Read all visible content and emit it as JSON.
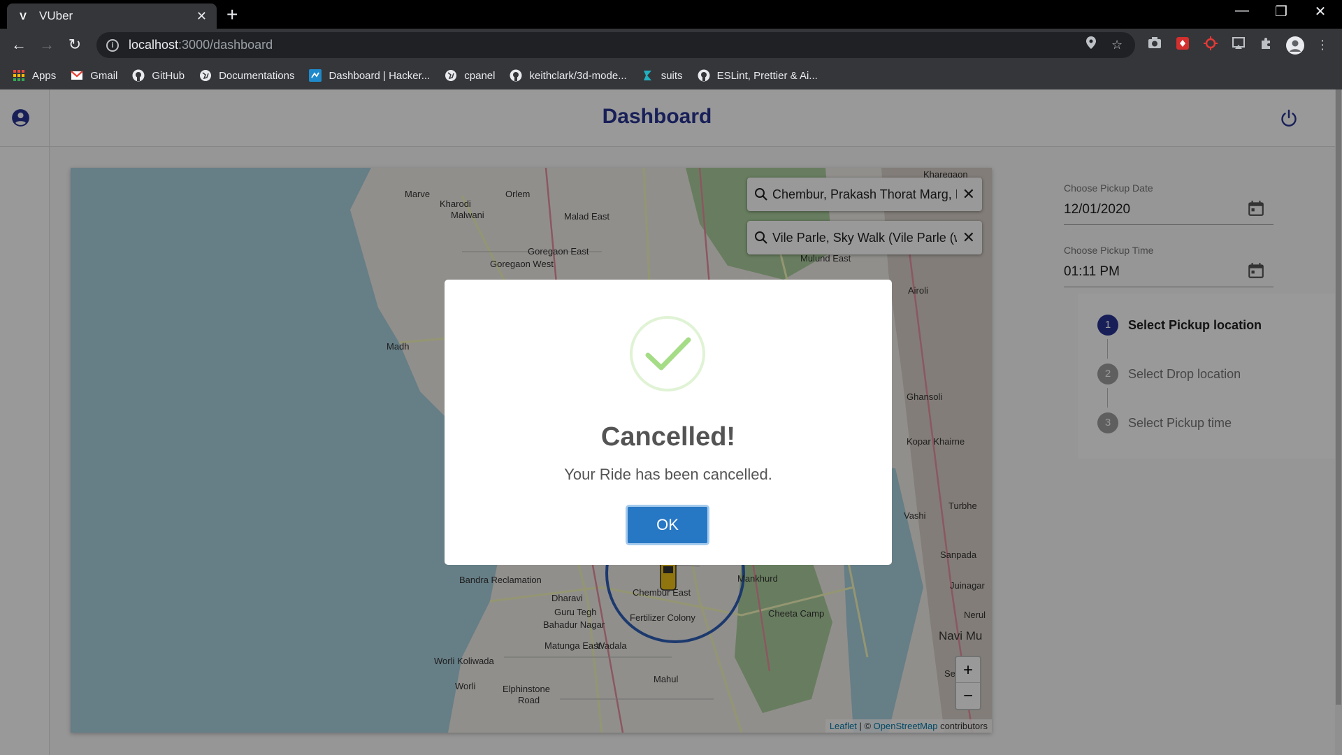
{
  "browser": {
    "tab_title": "VUber",
    "tab_close": "✕",
    "new_tab": "+",
    "url_host": "localhost",
    "url_path": ":3000/dashboard",
    "window_controls": [
      "—",
      "❐",
      "✕"
    ]
  },
  "bookmarks": [
    {
      "label": "Apps",
      "icon": "apps-grid-icon",
      "color": "#e8453c"
    },
    {
      "label": "Gmail",
      "icon": "gmail-icon",
      "color": "#ea4335"
    },
    {
      "label": "GitHub",
      "icon": "github-icon",
      "color": "#e8eaed"
    },
    {
      "label": "Documentations",
      "icon": "globe-icon",
      "color": "#e8eaed"
    },
    {
      "label": "Dashboard | Hacker...",
      "icon": "hackerrank-icon",
      "color": "#1f8acb"
    },
    {
      "label": "cpanel",
      "icon": "globe-icon",
      "color": "#e8eaed"
    },
    {
      "label": "keithclark/3d-mode...",
      "icon": "github-icon",
      "color": "#e8eaed"
    },
    {
      "label": "suits",
      "icon": "suits-icon",
      "color": "#21b0c0"
    },
    {
      "label": "ESLint, Prettier & Ai...",
      "icon": "github-icon",
      "color": "#e8eaed"
    }
  ],
  "app": {
    "title": "Dashboard",
    "accent": "#283593"
  },
  "map": {
    "search_pickup": "Chembur, Prakash Thorat Marg, P",
    "search_drop": "Vile Parle, Sky Walk (Vile Parle (w",
    "zoom_in": "+",
    "zoom_out": "−",
    "attribution_leaflet": "Leaflet",
    "attribution_sep": " | © ",
    "attribution_osm": "OpenStreetMap",
    "attribution_rest": " contributors",
    "labels": [
      "Kharegaon",
      "Marve",
      "Kharodi",
      "Orlem",
      "Malwani",
      "Malad East",
      "Goregaon East",
      "Goregaon West",
      "Mulund East",
      "Airoli",
      "Madh",
      "Ghansoli",
      "Kopar Khairne",
      "Turbhe",
      "Vashi",
      "Sanpada",
      "Juinagar",
      "Nerul",
      "Navi Mu",
      "Bandra Reclamation",
      "Dharavi",
      "Guru Tegh",
      "Bahadur Nagar",
      "Chembur East",
      "Fertilizer Colony",
      "Mankhurd",
      "Cheeta Camp",
      "Matunga East",
      "Wadala",
      "Worli Koliwada",
      "Worli",
      "Elphinstone",
      "Road",
      "Mahul",
      "Se"
    ]
  },
  "form": {
    "date_label": "Choose Pickup Date",
    "date_value": "12/01/2020",
    "time_label": "Choose Pickup Time",
    "time_value": "01:11 PM"
  },
  "stepper": {
    "active_step": 1,
    "steps": [
      {
        "num": "1",
        "label": "Select Pickup location"
      },
      {
        "num": "2",
        "label": "Select Drop location"
      },
      {
        "num": "3",
        "label": "Select Pickup time"
      }
    ]
  },
  "modal": {
    "title": "Cancelled!",
    "text": "Your Ride has been cancelled.",
    "ok_label": "OK",
    "icon": "success-check-icon",
    "check_color": "#a5dc86",
    "button_color": "#2778c4"
  }
}
